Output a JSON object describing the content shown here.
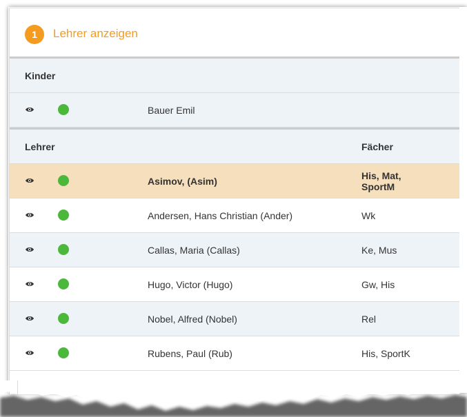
{
  "header": {
    "step_number": "1",
    "title": "Lehrer anzeigen"
  },
  "children_section": {
    "heading": "Kinder",
    "rows": [
      {
        "name": "Bauer Emil",
        "status": "green"
      }
    ]
  },
  "teachers_section": {
    "heading": "Lehrer",
    "subjects_heading": "Fächer",
    "rows": [
      {
        "name": "Asimov, (Asim)",
        "subjects": "His, Mat, SportM",
        "selected": true,
        "status": "green"
      },
      {
        "name": "Andersen, Hans Christian (Ander)",
        "subjects": "Wk",
        "status": "green"
      },
      {
        "name": "Callas, Maria (Callas)",
        "subjects": "Ke, Mus",
        "status": "green"
      },
      {
        "name": "Hugo, Victor (Hugo)",
        "subjects": "Gw, His",
        "status": "green"
      },
      {
        "name": "Nobel, Alfred (Nobel)",
        "subjects": "Rel",
        "status": "green"
      },
      {
        "name": "Rubens, Paul (Rub)",
        "subjects": "His, SportK",
        "status": "green"
      }
    ]
  },
  "colors": {
    "accent": "#f39c1f",
    "status_green": "#4cb83b",
    "selected_row": "#f5dfbc",
    "alt_row": "#eef3f8"
  },
  "icons": {
    "view": "eye-icon",
    "status": "status-dot-icon"
  }
}
